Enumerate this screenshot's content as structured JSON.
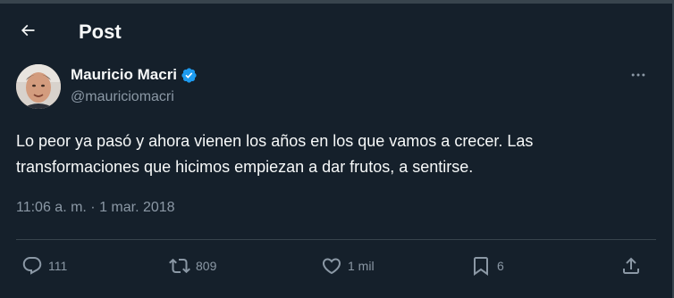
{
  "header": {
    "title": "Post",
    "back_icon": "arrow-left-icon"
  },
  "author": {
    "name": "Mauricio Macri",
    "handle": "@mauriciomacri",
    "verified": true,
    "verified_color": "#1d9bf0"
  },
  "post": {
    "text": "Lo peor ya pasó y ahora vienen los años en los que vamos a crecer. Las transformaciones que hicimos empiezan a dar frutos, a sentirse.",
    "timestamp": "11:06 a. m. · 1 mar. 2018"
  },
  "actions": {
    "reply": {
      "icon": "reply-icon",
      "count": "111"
    },
    "repost": {
      "icon": "repost-icon",
      "count": "809"
    },
    "like": {
      "icon": "heart-icon",
      "count": "1 mil"
    },
    "bookmark": {
      "icon": "bookmark-icon",
      "count": "6"
    },
    "share": {
      "icon": "share-icon"
    }
  },
  "theme": {
    "background": "#15202b",
    "text": "#f7f9f9",
    "secondary_text": "#8b98a5",
    "border": "#38444d"
  }
}
